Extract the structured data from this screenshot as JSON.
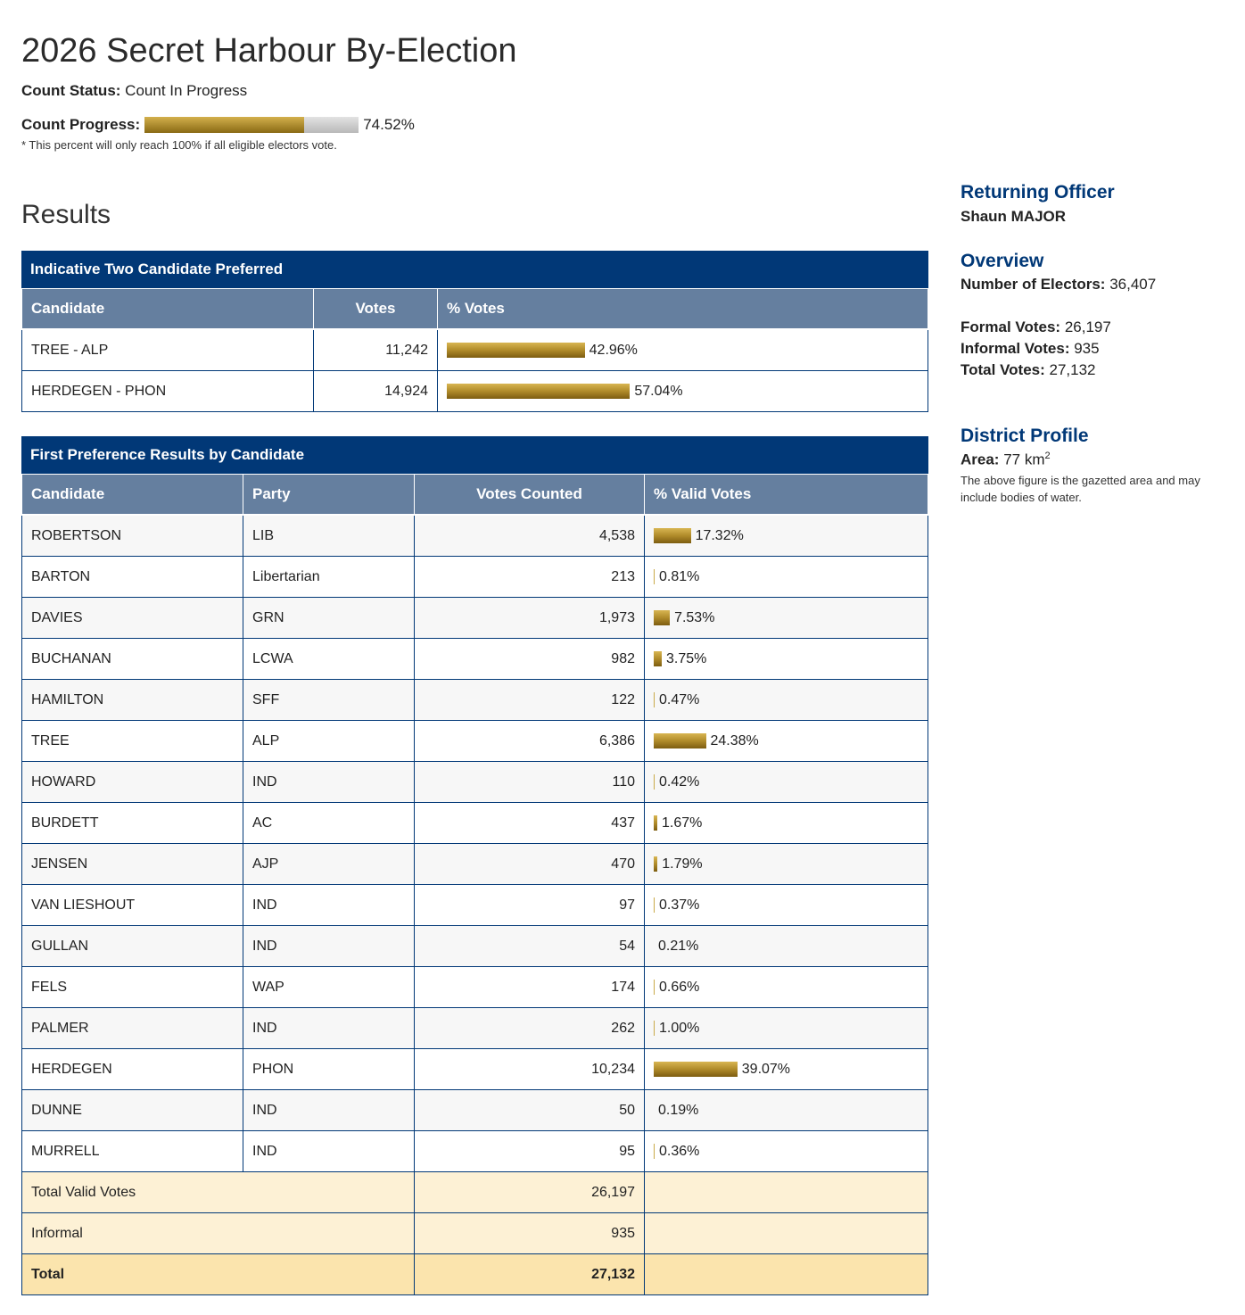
{
  "page": {
    "title": "2026 Secret Harbour By-Election",
    "count_status_label": "Count Status:",
    "count_status_value": "Count In Progress",
    "count_progress_label": "Count Progress:",
    "count_progress_percent": 74.52,
    "count_progress_text": "74.52%",
    "footnote": "* This percent will only reach 100% if all eligible electors vote.",
    "results_heading": "Results"
  },
  "tcp": {
    "caption": "Indicative Two Candidate Preferred",
    "headers": [
      "Candidate",
      "Votes",
      "% Votes"
    ],
    "rows": [
      {
        "candidate": "TREE - ALP",
        "votes": "11,242",
        "pct": 42.96,
        "pct_text": "42.96%"
      },
      {
        "candidate": "HERDEGEN - PHON",
        "votes": "14,924",
        "pct": 57.04,
        "pct_text": "57.04%"
      }
    ]
  },
  "fp": {
    "caption": "First Preference Results by Candidate",
    "headers": [
      "Candidate",
      "Party",
      "Votes Counted",
      "% Valid Votes"
    ],
    "rows": [
      {
        "candidate": "ROBERTSON",
        "party": "LIB",
        "votes": "4,538",
        "pct": 17.32,
        "pct_text": "17.32%"
      },
      {
        "candidate": "BARTON",
        "party": "Libertarian",
        "votes": "213",
        "pct": 0.81,
        "pct_text": "0.81%"
      },
      {
        "candidate": "DAVIES",
        "party": "GRN",
        "votes": "1,973",
        "pct": 7.53,
        "pct_text": "7.53%"
      },
      {
        "candidate": "BUCHANAN",
        "party": "LCWA",
        "votes": "982",
        "pct": 3.75,
        "pct_text": "3.75%"
      },
      {
        "candidate": "HAMILTON",
        "party": "SFF",
        "votes": "122",
        "pct": 0.47,
        "pct_text": "0.47%"
      },
      {
        "candidate": "TREE",
        "party": "ALP",
        "votes": "6,386",
        "pct": 24.38,
        "pct_text": "24.38%"
      },
      {
        "candidate": "HOWARD",
        "party": "IND",
        "votes": "110",
        "pct": 0.42,
        "pct_text": "0.42%"
      },
      {
        "candidate": "BURDETT",
        "party": "AC",
        "votes": "437",
        "pct": 1.67,
        "pct_text": "1.67%"
      },
      {
        "candidate": "JENSEN",
        "party": "AJP",
        "votes": "470",
        "pct": 1.79,
        "pct_text": "1.79%"
      },
      {
        "candidate": "VAN LIESHOUT",
        "party": "IND",
        "votes": "97",
        "pct": 0.37,
        "pct_text": "0.37%"
      },
      {
        "candidate": "GULLAN",
        "party": "IND",
        "votes": "54",
        "pct": 0.21,
        "pct_text": "0.21%"
      },
      {
        "candidate": "FELS",
        "party": "WAP",
        "votes": "174",
        "pct": 0.66,
        "pct_text": "0.66%"
      },
      {
        "candidate": "PALMER",
        "party": "IND",
        "votes": "262",
        "pct": 1.0,
        "pct_text": "1.00%"
      },
      {
        "candidate": "HERDEGEN",
        "party": "PHON",
        "votes": "10,234",
        "pct": 39.07,
        "pct_text": "39.07%"
      },
      {
        "candidate": "DUNNE",
        "party": "IND",
        "votes": "50",
        "pct": 0.19,
        "pct_text": "0.19%"
      },
      {
        "candidate": "MURRELL",
        "party": "IND",
        "votes": "95",
        "pct": 0.36,
        "pct_text": "0.36%"
      }
    ],
    "totals": [
      {
        "label": "Total Valid Votes",
        "value": "26,197"
      },
      {
        "label": "Informal",
        "value": "935"
      },
      {
        "label": "Total",
        "value": "27,132"
      }
    ]
  },
  "side": {
    "returning_officer_heading": "Returning Officer",
    "returning_officer_name": "Shaun MAJOR",
    "overview_heading": "Overview",
    "electors_label": "Number of Electors:",
    "electors_value": "36,407",
    "formal_label": "Formal Votes:",
    "formal_value": "26,197",
    "informal_label": "Informal Votes:",
    "informal_value": "935",
    "total_label": "Total Votes:",
    "total_value": "27,132",
    "district_heading": "District Profile",
    "area_label": "Area:",
    "area_value": "77 km",
    "area_sup": "2",
    "area_note": "The above figure is the gazetted area and may include bodies of water."
  },
  "colors": {
    "navy": "#013877",
    "header_slate": "#657f9f",
    "gold": "#b08b2a"
  }
}
